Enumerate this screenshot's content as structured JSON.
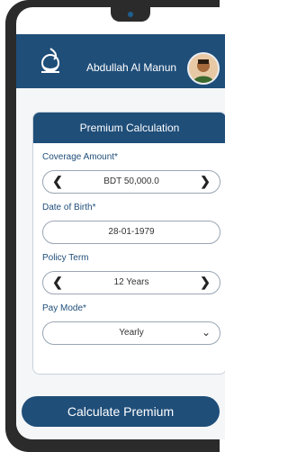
{
  "header": {
    "user_name": "Abdullah Al Manun"
  },
  "card": {
    "title": "Premium Calculation",
    "fields": [
      {
        "label": "Coverage Amount*",
        "value": "BDT 50,000.0",
        "control": "stepper"
      },
      {
        "label": "Date of Birth*",
        "value": "28-01-1979",
        "control": "date"
      },
      {
        "label": "Policy Term",
        "value": "12 Years",
        "control": "stepper"
      },
      {
        "label": "Pay Mode*",
        "value": "Yearly",
        "control": "dropdown"
      }
    ]
  },
  "actions": {
    "calculate_label": "Calculate Premium"
  },
  "colors": {
    "primary": "#1f4e79",
    "background": "#f4f6f8",
    "border": "#9aa6b3"
  },
  "icons": {
    "decrement": "chevron-left-icon",
    "increment": "chevron-right-icon",
    "dropdown": "chevron-down-icon"
  }
}
